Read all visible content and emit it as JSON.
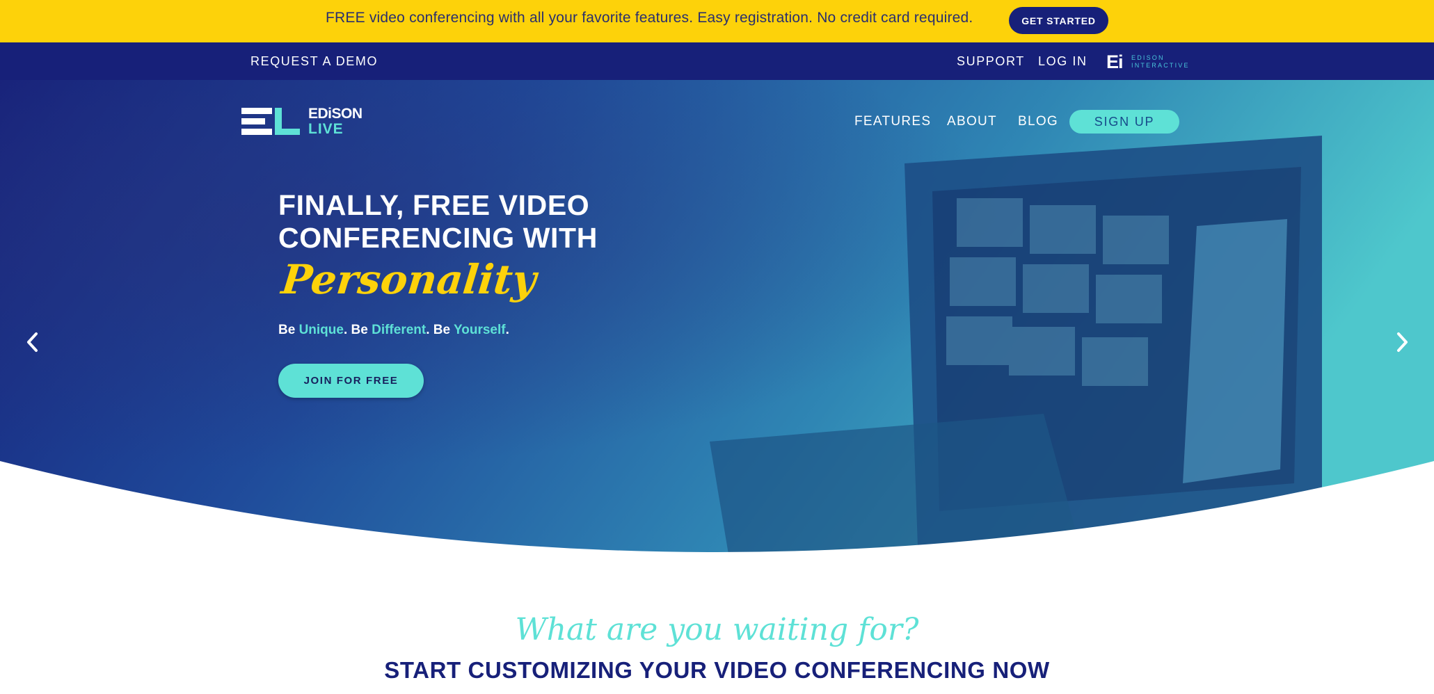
{
  "promo_bar": {
    "message": "FREE video conferencing with all your favorite features. Easy registration. No credit card required.",
    "cta": "GET STARTED"
  },
  "top_nav": {
    "request_demo": "REQUEST A DEMO",
    "support": "SUPPORT",
    "login": "LOG IN",
    "partner_logo_mark": "Ei",
    "partner_logo_text_1": "EDISON",
    "partner_logo_text_2": "INTERACTIVE"
  },
  "brand": {
    "mark": "EL",
    "name_1": "EDiSON",
    "name_2": "LIVE"
  },
  "main_nav": {
    "items": [
      "FEATURES",
      "ABOUT",
      "BLOG"
    ],
    "signup": "SIGN UP"
  },
  "hero": {
    "headline_1": "FINALLY, FREE VIDEO",
    "headline_2": "CONFERENCING WITH",
    "script_word": "Personality",
    "tagline": {
      "be_1": "Be ",
      "w1": "Unique",
      "sep_1": ". Be ",
      "w2": "Different",
      "sep_2": ". Be ",
      "w3": "Yourself",
      "end": "."
    },
    "cta": "JOIN FOR FREE",
    "prev_icon": "chevron-left-icon",
    "next_icon": "chevron-right-icon"
  },
  "section": {
    "script_heading": "What are you waiting for?",
    "heading": "START CUSTOMIZING YOUR VIDEO CONFERENCING NOW"
  },
  "colors": {
    "yellow": "#fdd20a",
    "navy": "#172079",
    "teal": "#5ee1d6"
  }
}
